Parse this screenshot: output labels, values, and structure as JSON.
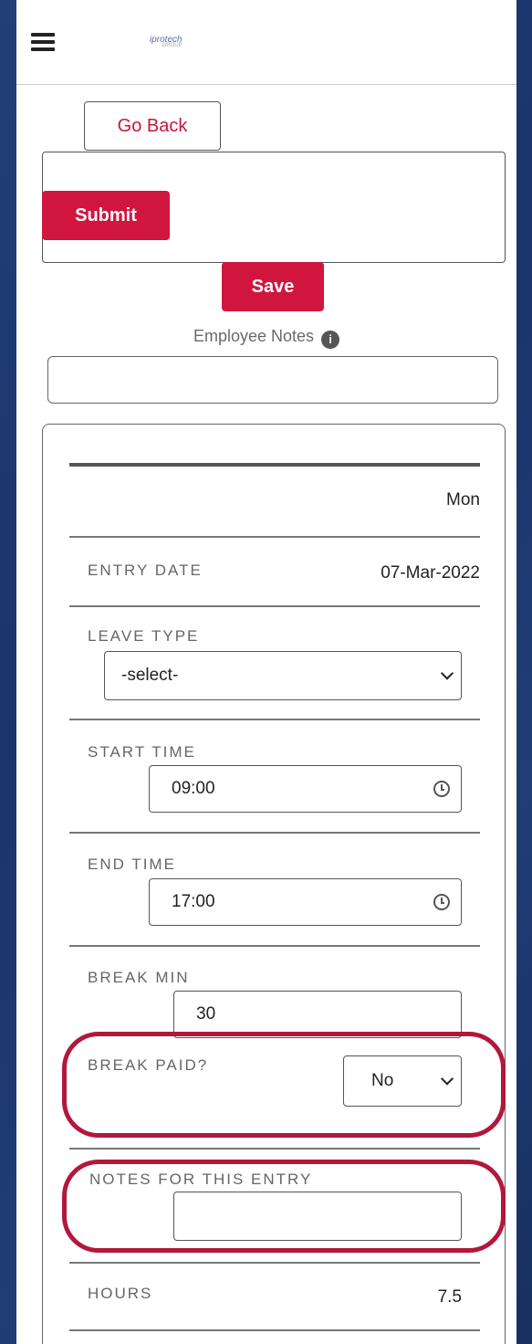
{
  "header": {
    "logo_text": "iprotech",
    "logo_sub": "GROUP"
  },
  "actions": {
    "go_back": "Go Back",
    "submit": "Submit",
    "save": "Save"
  },
  "employee_notes": {
    "label": "Employee Notes",
    "value": ""
  },
  "entry": {
    "day": "Mon",
    "entry_date_label": "ENTRY DATE",
    "entry_date_value": "07-Mar-2022",
    "leave_type_label": "LEAVE TYPE",
    "leave_type_value": "-select-",
    "start_time_label": "START TIME",
    "start_time_value": "09:00",
    "end_time_label": "END TIME",
    "end_time_value": "17:00",
    "break_min_label": "BREAK MIN",
    "break_min_value": "30",
    "break_paid_label": "BREAK PAID?",
    "break_paid_value": "No",
    "notes_label": "NOTES FOR THIS ENTRY",
    "notes_value": "",
    "hours_label": "HOURS",
    "hours_value": "7.5"
  },
  "colors": {
    "accent": "#d0163f",
    "highlight_ring": "#b2183c",
    "background": "#1d3a72"
  }
}
